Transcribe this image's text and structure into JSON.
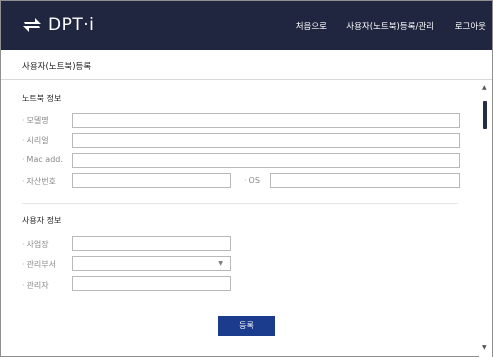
{
  "app": {
    "brand": "DPT·i"
  },
  "nav": {
    "home": "처음으로",
    "register_manage": "사용자(노트북)등록/관리",
    "logout": "로그아웃"
  },
  "page": {
    "title": "사용자(노트북)등록"
  },
  "notebook": {
    "section_title": "노트북 정보",
    "model_label": "모델명",
    "serial_label": "시리얼",
    "mac_label": "Mac add.",
    "asset_label": "자산번호",
    "os_label": "OS",
    "model_value": "",
    "serial_value": "",
    "mac_value": "",
    "asset_value": "",
    "os_value": ""
  },
  "user": {
    "section_title": "사용자 정보",
    "site_label": "사업장",
    "dept_label": "관리부서",
    "manager_label": "관리자",
    "site_value": "",
    "dept_value": "",
    "manager_value": ""
  },
  "actions": {
    "submit_label": "등록"
  },
  "colors": {
    "header_bg": "#202640",
    "accent": "#1b3b8c",
    "thumb": "#252e44"
  }
}
